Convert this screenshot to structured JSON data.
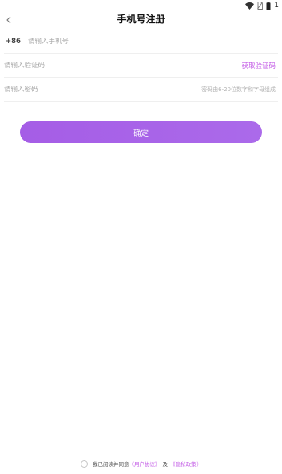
{
  "status_bar": {
    "battery_level": "1",
    "icons": [
      "wifi-icon",
      "no-sim-icon",
      "battery-icon"
    ]
  },
  "header": {
    "back_icon": "chevron-left-icon",
    "title": "手机号注册"
  },
  "form": {
    "country_code": "+86",
    "phone_placeholder": "请输入手机号",
    "phone_value": "",
    "code_placeholder": "请输入验证码",
    "code_value": "",
    "get_code_label": "获取验证码",
    "password_placeholder": "请输入密码",
    "password_value": "",
    "password_hint": "密码由6-20位数字和字母组成"
  },
  "confirm_label": "确定",
  "agreement": {
    "checked": false,
    "prefix": "我已阅读并同意",
    "user_agreement": "《用户协议》",
    "joiner": "及",
    "privacy_policy": "《隐私政策》"
  },
  "colors": {
    "accent": "#c35ce6",
    "button": "#a55de6",
    "divider": "#efefef",
    "placeholder": "#a8a8a8"
  }
}
